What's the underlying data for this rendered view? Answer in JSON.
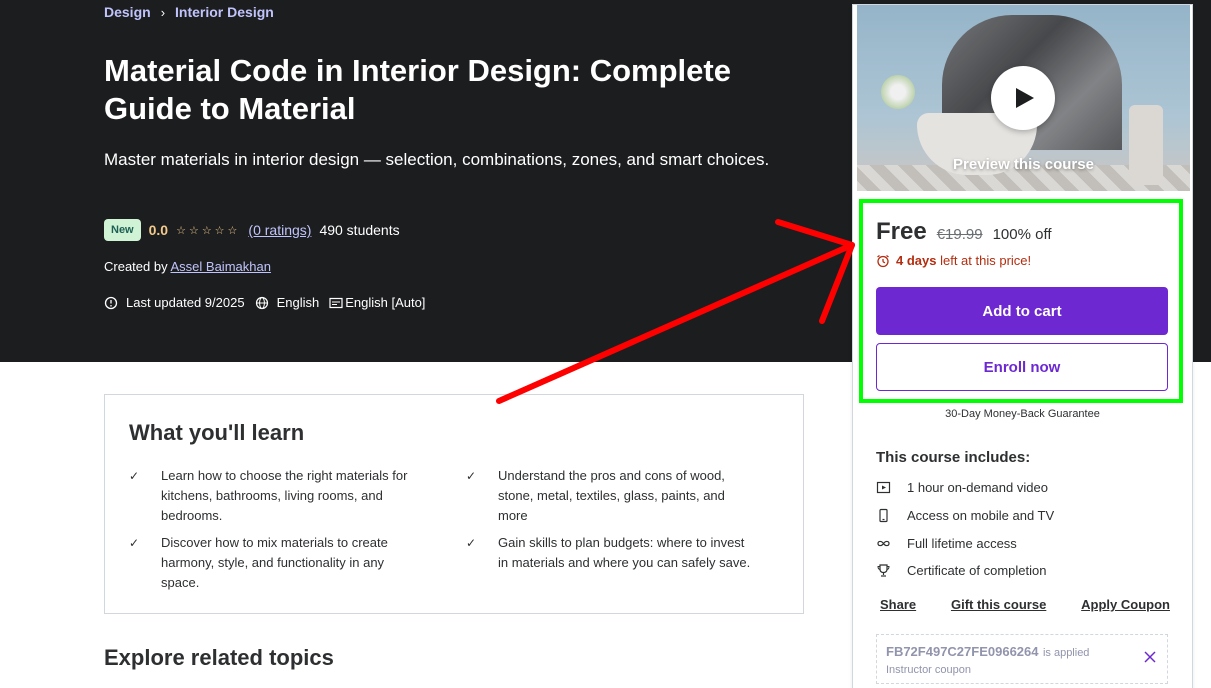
{
  "breadcrumb": {
    "items": [
      "Design",
      "Interior Design"
    ],
    "separator": "›"
  },
  "course": {
    "title": "Material Code in Interior Design: Complete Guide to Material",
    "subtitle": "Master materials in interior design — selection, combinations, zones, and smart choices.",
    "badge": "New",
    "rating": "0.0",
    "stars_filled": 0,
    "stars_total": 5,
    "ratings_link": "(0 ratings)",
    "students": "490 students",
    "created_by_label": "Created by",
    "instructor": "Assel Baimakhan",
    "last_updated": "Last updated 9/2025",
    "language": "English",
    "captions": "English [Auto]"
  },
  "learn": {
    "heading": "What you'll learn",
    "items": [
      "Learn how to choose the right materials for kitchens, bathrooms, living rooms, and bedrooms.",
      "Understand the pros and cons of wood, stone, metal, textiles, glass, paints, and more",
      "Discover how to mix materials to create harmony, style, and functionality in any space.",
      "Gain skills to plan budgets: where to invest in materials and where you can safely save."
    ]
  },
  "related_heading": "Explore related topics",
  "sidebar": {
    "preview_label": "Preview this course",
    "price": "Free",
    "original_price": "€19.99",
    "discount": "100% off",
    "timer_bold": "4 days",
    "timer_rest": " left at this price!",
    "add_to_cart": "Add to cart",
    "enroll_now": "Enroll now",
    "guarantee": "30-Day Money-Back Guarantee",
    "includes_title": "This course includes:",
    "includes": [
      {
        "icon": "video-icon",
        "label": "1 hour on-demand video"
      },
      {
        "icon": "mobile-icon",
        "label": "Access on mobile and TV"
      },
      {
        "icon": "infinity-icon",
        "label": "Full lifetime access"
      },
      {
        "icon": "trophy-icon",
        "label": "Certificate of completion"
      }
    ],
    "links": [
      "Share",
      "Gift this course",
      "Apply Coupon"
    ],
    "coupon": {
      "code": "FB72F497C27FE0966264",
      "applied": "is applied",
      "type": "Instructor coupon"
    }
  },
  "colors": {
    "hero_bg": "#1c1d1f",
    "accent_purple": "#6d28d2",
    "link_lavender": "#c0c4fc",
    "rating_gold": "#f3ca8c",
    "timer_red": "#b32d0f",
    "highlight_green": "#00ff00",
    "arrow_red": "#ff0000"
  }
}
